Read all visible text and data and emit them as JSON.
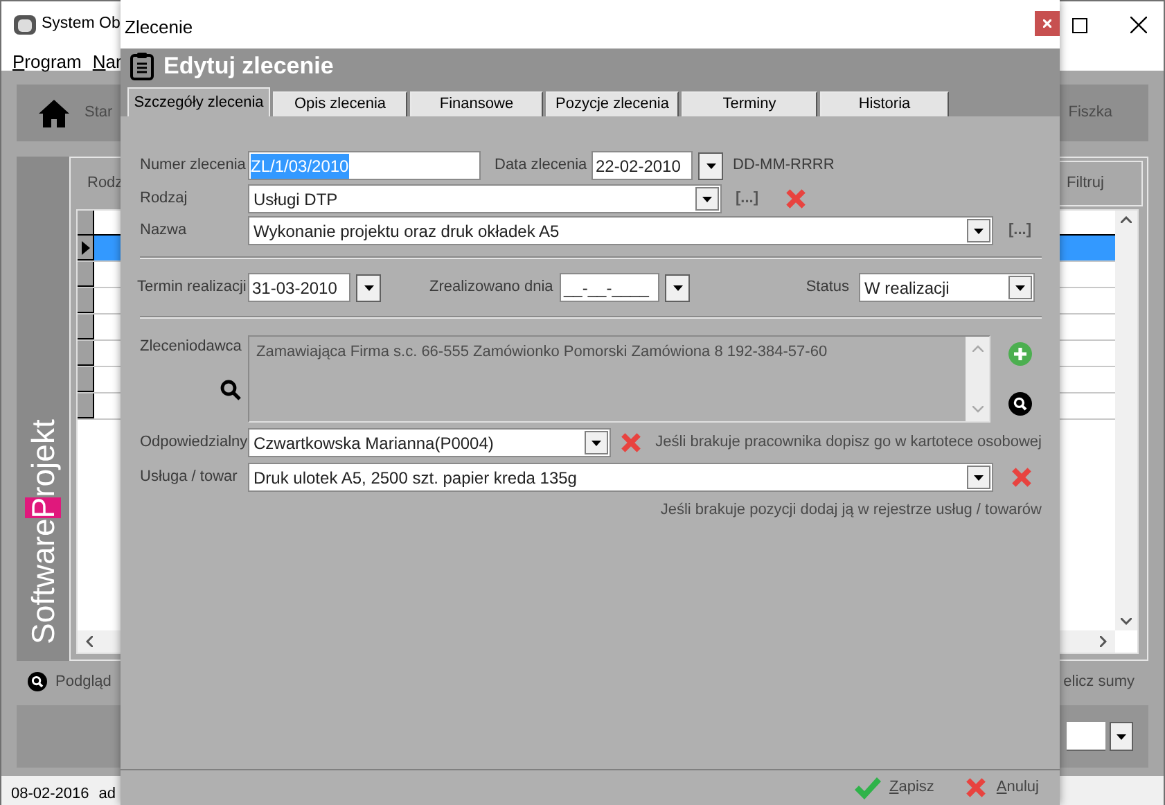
{
  "main_window": {
    "title": "System Ob",
    "menu": [
      {
        "mnemonic": "P",
        "rest": "rogram"
      },
      {
        "mnemonic": "N",
        "rest": "ar"
      }
    ],
    "toolbar": {
      "left_label": "Star",
      "right_label": "Fiszka"
    },
    "logo": {
      "before": "Software",
      "highlight": "P",
      "after": "rojekt"
    },
    "grid": {
      "filter_label": "Rodz",
      "filter_button": "Filtruj",
      "rows": [
        {
          "selected": true
        },
        {
          "selected": false
        },
        {
          "selected": false
        },
        {
          "selected": false
        },
        {
          "selected": false
        },
        {
          "selected": false
        },
        {
          "selected": false
        }
      ]
    },
    "preview_link": "Podgląd",
    "sums_link": "elicz sumy",
    "status_bar": [
      "08-02-2016",
      "ad"
    ]
  },
  "dialog": {
    "title": "Zlecenie",
    "header": "Edytuj zlecenie",
    "tabs": [
      {
        "label": "Szczegóły zlecenia",
        "selected": true
      },
      {
        "label": "Opis zlecenia",
        "selected": false
      },
      {
        "label": "Finansowe",
        "selected": false
      },
      {
        "label": "Pozycje zlecenia",
        "selected": false
      },
      {
        "label": "Terminy",
        "selected": false
      },
      {
        "label": "Historia",
        "selected": false
      }
    ],
    "order_number": {
      "label": "Numer zlecenia",
      "value": "ZL/1/03/2010",
      "text_selected": true
    },
    "order_date": {
      "label": "Data zlecenia",
      "value": "22-02-2010",
      "format_hint": "DD-MM-RRRR"
    },
    "kind": {
      "label": "Rodzaj",
      "value": "Usługi DTP",
      "more": "[...]"
    },
    "name": {
      "label": "Nazwa",
      "value": "Wykonanie projektu oraz druk okładek A5",
      "more": "[...]"
    },
    "due_date": {
      "label": "Termin realizacji",
      "value": "31-03-2010"
    },
    "completed_date": {
      "label": "Zrealizowano dnia",
      "value": "__-__-____"
    },
    "status": {
      "label": "Status",
      "value": "W realizacji"
    },
    "client": {
      "label": "Zleceniodawca",
      "value": "Zamawiająca Firma s.c. 66-555 Zamówionko Pomorski Zamówiona 8 192-384-57-60"
    },
    "responsible": {
      "label": "Odpowiedzialny",
      "value": "Czwartkowska Marianna(P0004)",
      "hint": "Jeśli brakuje pracownika dopisz go w kartotece osobowej"
    },
    "service": {
      "label": "Usługa / towar",
      "value": "Druk ulotek A5, 2500 szt. papier kreda 135g",
      "hint": "Jeśli brakuje pozycji dodaj ją w rejestrze usług / towarów"
    },
    "buttons": [
      {
        "kind": "save",
        "mnemonic": "Z",
        "rest": "apisz"
      },
      {
        "kind": "cancel",
        "mnemonic": "A",
        "rest": "nuluj"
      }
    ]
  }
}
